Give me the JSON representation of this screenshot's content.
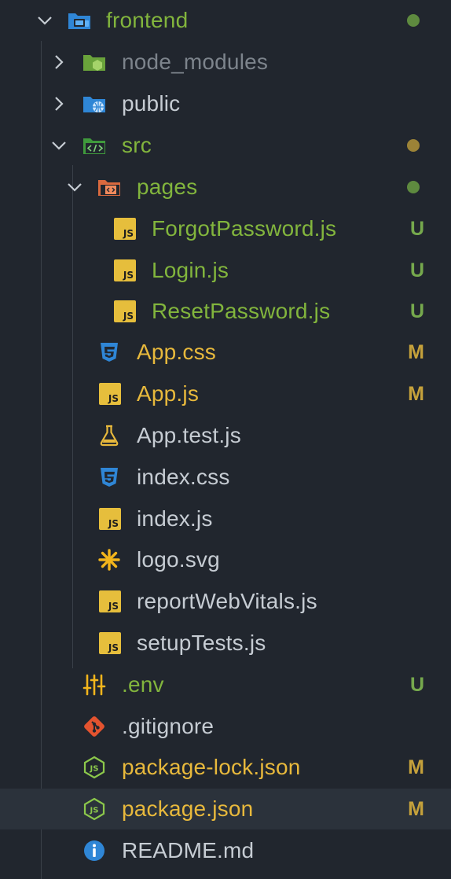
{
  "colors": {
    "background": "#21262e",
    "untracked": "#82b53d",
    "modified": "#e8b93c",
    "normal": "#c6ccd3",
    "ignored": "#7d848c",
    "dot_green": "#5e8a3f",
    "dot_yellow": "#9c8337"
  },
  "tree": {
    "frontend": {
      "label": "frontend",
      "icon": "folder-frontend-icon"
    },
    "node_modules": {
      "label": "node_modules",
      "icon": "folder-node-icon"
    },
    "public": {
      "label": "public",
      "icon": "folder-public-icon"
    },
    "src": {
      "label": "src",
      "icon": "folder-src-icon"
    },
    "pages": {
      "label": "pages",
      "icon": "folder-pages-icon"
    },
    "forgot": {
      "label": "ForgotPassword.js",
      "badge": "U",
      "icon": "js-icon"
    },
    "login": {
      "label": "Login.js",
      "badge": "U",
      "icon": "js-icon"
    },
    "reset": {
      "label": "ResetPassword.js",
      "badge": "U",
      "icon": "js-icon"
    },
    "appcss": {
      "label": "App.css",
      "badge": "M",
      "icon": "css-icon"
    },
    "appjs": {
      "label": "App.js",
      "badge": "M",
      "icon": "js-icon"
    },
    "apptest": {
      "label": "App.test.js",
      "icon": "test-flask-icon"
    },
    "indexcss": {
      "label": "index.css",
      "icon": "css-icon"
    },
    "indexjs": {
      "label": "index.js",
      "icon": "js-icon"
    },
    "logo": {
      "label": "logo.svg",
      "icon": "svg-asterisk-icon"
    },
    "report": {
      "label": "reportWebVitals.js",
      "icon": "js-icon"
    },
    "setup": {
      "label": "setupTests.js",
      "icon": "js-icon"
    },
    "env": {
      "label": ".env",
      "badge": "U",
      "icon": "env-sliders-icon"
    },
    "gitignore": {
      "label": ".gitignore",
      "icon": "git-icon"
    },
    "pkglock": {
      "label": "package-lock.json",
      "badge": "M",
      "icon": "nodejs-icon"
    },
    "pkg": {
      "label": "package.json",
      "badge": "M",
      "icon": "nodejs-icon"
    },
    "readme": {
      "label": "README.md",
      "icon": "info-icon"
    }
  },
  "js_glyph": "JS"
}
